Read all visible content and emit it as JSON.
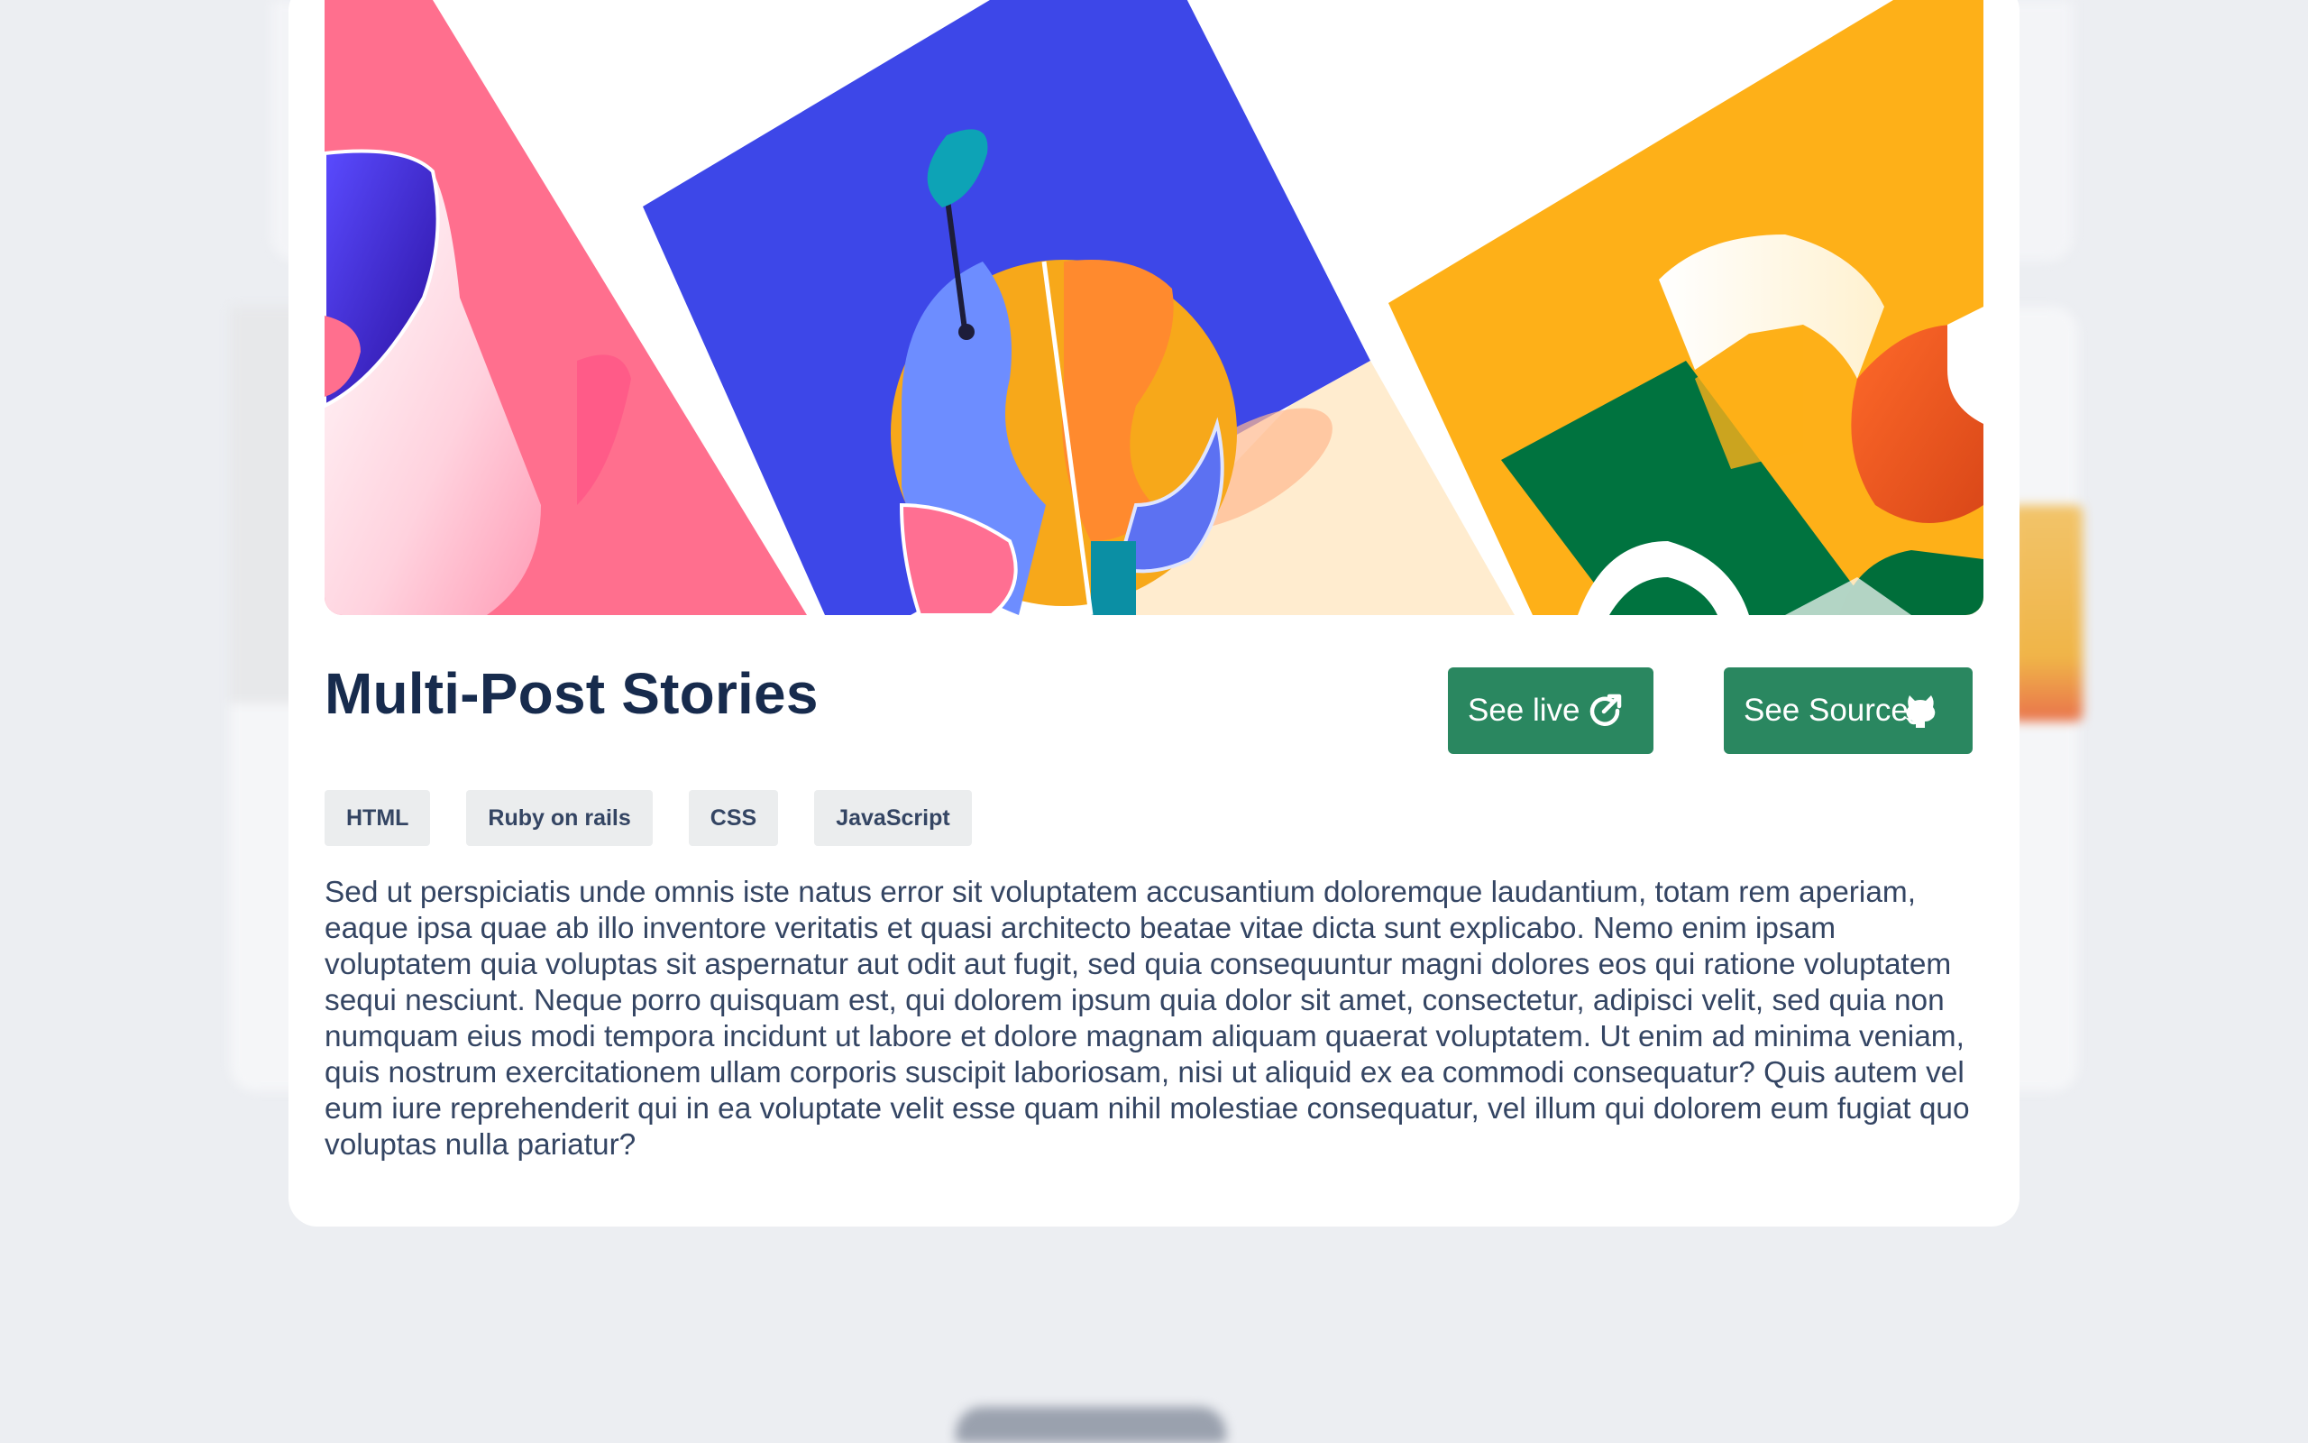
{
  "project": {
    "title": "Multi-Post Stories",
    "see_live_label": "See live",
    "see_source_label": "See Source",
    "tags": [
      "HTML",
      "Ruby on rails",
      "CSS",
      "JavaScript"
    ],
    "description": "Sed ut perspiciatis unde omnis iste natus error sit voluptatem accusantium doloremque laudantium, totam rem aperiam, eaque ipsa quae ab illo inventore veritatis et quasi architecto beatae vitae dicta sunt explicabo. Nemo enim ipsam voluptatem quia voluptas sit aspernatur aut odit aut fugit, sed quia consequuntur magni dolores eos qui ratione voluptatem sequi nesciunt. Neque porro quisquam est, qui dolorem ipsum quia dolor sit amet, consectetur, adipisci velit, sed quia non numquam eius modi tempora incidunt ut labore et dolore magnam aliquam quaerat voluptatem. Ut enim ad minima veniam, quis nostrum exercitationem ullam corporis suscipit laboriosam, nisi ut aliquid ex ea commodi consequatur? Quis autem vel eum iure reprehenderit qui in ea voluptate velit esse quam nihil molestiae consequatur, vel illum qui dolorem eum fugiat quo voluptas nulla pariatur?"
  },
  "icons": {
    "see_live": "external-link-icon",
    "see_source": "github-icon"
  },
  "colors": {
    "button_bg": "#2a8760",
    "title": "#172b4d",
    "text": "#344563",
    "tag_bg": "#ebedee",
    "page_bg": "#eceef2"
  }
}
